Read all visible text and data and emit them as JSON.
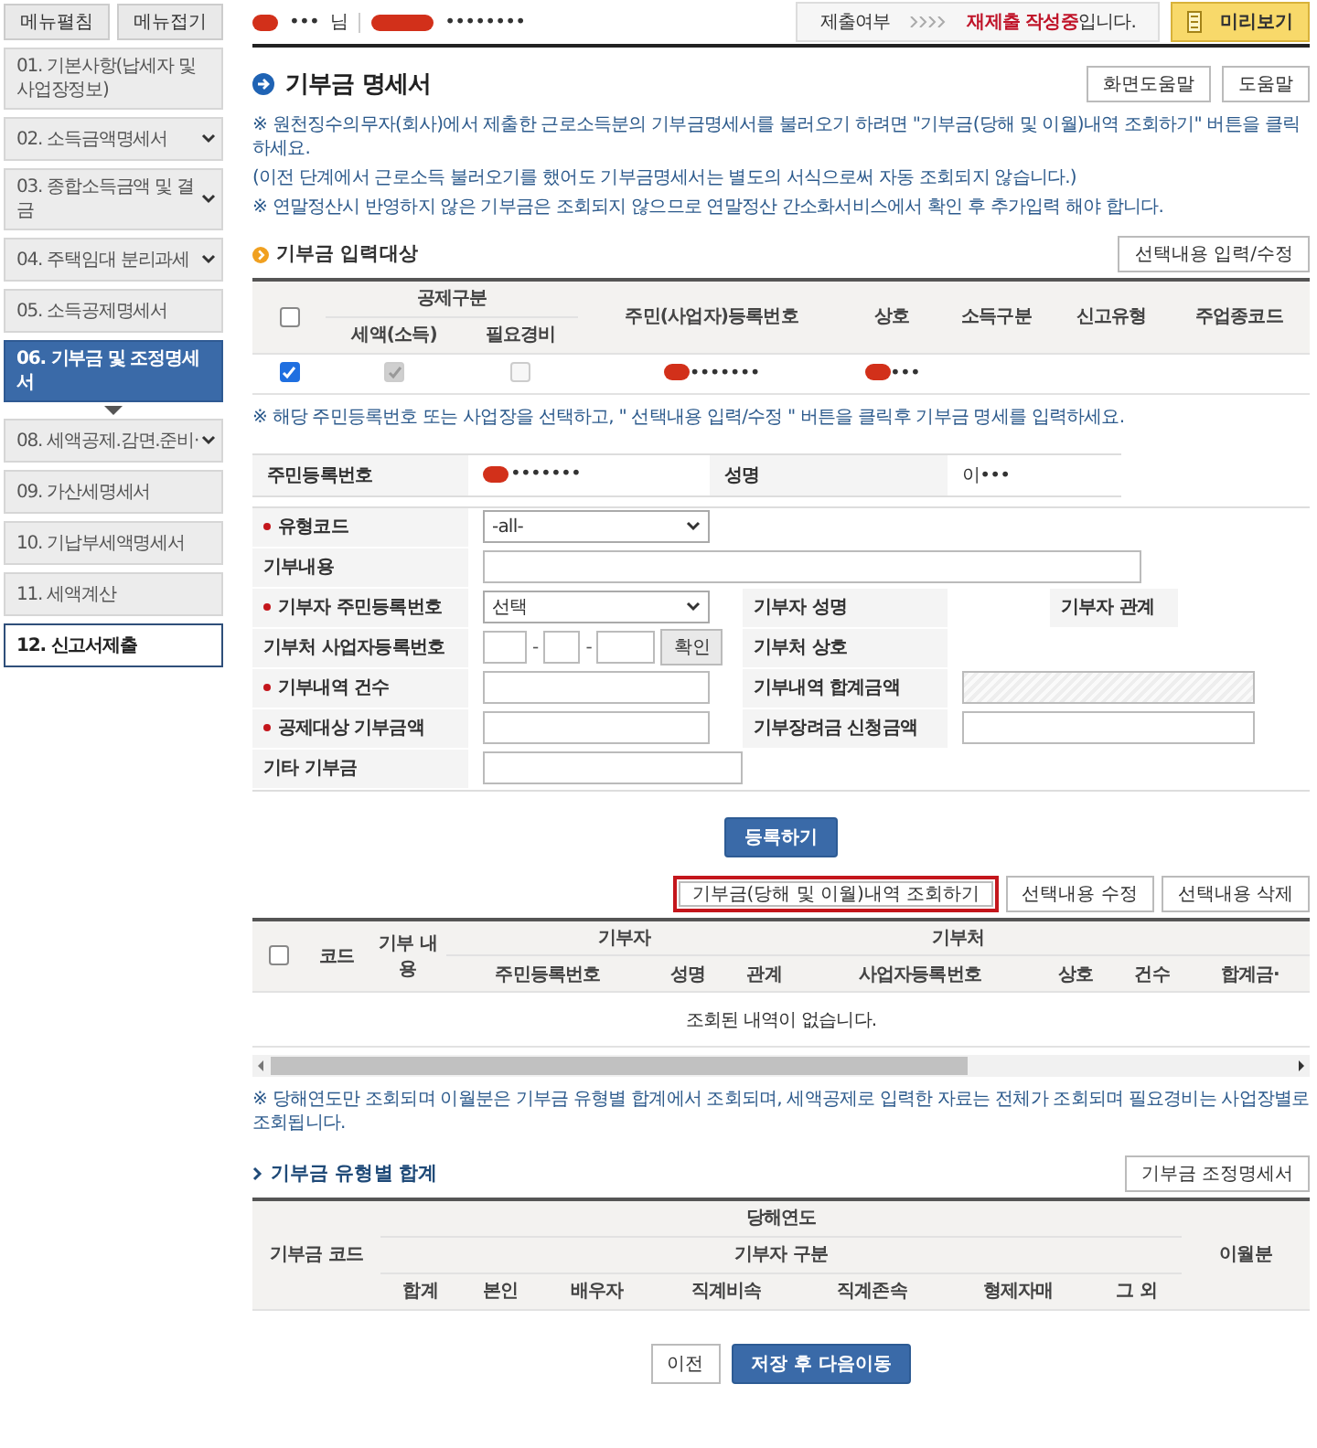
{
  "sidebar": {
    "buttons": [
      "메뉴펼침",
      "메뉴접기"
    ],
    "items": [
      {
        "label": "01. 기본사항(납세자 및 사업장정보)",
        "selected": false,
        "expandable": false,
        "emphasized": false
      },
      {
        "label": "02. 소득금액명세서",
        "selected": false,
        "expandable": true,
        "emphasized": false
      },
      {
        "label": "03. 종합소득금액 및 결 금",
        "selected": false,
        "expandable": true,
        "emphasized": false
      },
      {
        "label": "04. 주택임대 분리과세",
        "selected": false,
        "expandable": true,
        "emphasized": false
      },
      {
        "label": "05. 소득공제명세서",
        "selected": false,
        "expandable": false,
        "emphasized": false
      },
      {
        "label": "06. 기부금 및 조정명세서",
        "selected": true,
        "expandable": false,
        "emphasized": false
      },
      {
        "label": "08. 세액공제.감면.준비·",
        "selected": false,
        "expandable": true,
        "emphasized": false
      },
      {
        "label": "09. 가산세명세서",
        "selected": false,
        "expandable": false,
        "emphasized": false
      },
      {
        "label": "10. 기납부세액명세서",
        "selected": false,
        "expandable": false,
        "emphasized": false
      },
      {
        "label": "11. 세액계산",
        "selected": false,
        "expandable": false,
        "emphasized": false
      },
      {
        "label": "12. 신고서제출",
        "selected": false,
        "expandable": false,
        "emphasized": true
      }
    ]
  },
  "header": {
    "user": {
      "text": "•••",
      "redacted": true
    },
    "user_suffix": "님",
    "account": {
      "text": "••••••••",
      "redacted": true
    },
    "status": {
      "label": "제출여부",
      "value": "**재제출 작성중**입니다."
    },
    "preview_button": "미리보기"
  },
  "title": "기부금 명세서",
  "help_buttons": [
    "화면도움말",
    "도움말"
  ],
  "notes": [
    "※ 원천징수의무자(회사)에서 제출한 근로소득분의 기부금명세서를 불러오기 하려면 \"기부금(당해 및 이월)내역 조회하기\" 버튼을 클릭하세요.",
    "(이전 단계에서 근로소득 불러오기를 했어도 기부금명세서는 별도의 서식으로써 자동 조회되지 않습니다.)",
    "※ 연말정산시 반영하지 않은 기부금은 조회되지 않으므로 연말정산 간소화서비스에서 확인 후 추가입력 해야 합니다."
  ],
  "target_section": {
    "title": "기부금 입력대상",
    "button": "선택내용 입력/수정",
    "select_all": {
      "checked": false
    },
    "group": {
      "label": "공제구분",
      "columns": [
        "세액(소득)",
        "필요경비"
      ]
    },
    "columns": [
      "주민(사업자)등록번호",
      "상호",
      "소득구분",
      "신고유형",
      "주업종코드"
    ],
    "rows": [
      {
        "checked": true,
        "deduction_checks": [
          {
            "checked": true,
            "disabled": true
          },
          {
            "checked": false,
            "disabled": true
          }
        ],
        "id": {
          "text": "•••••••",
          "redacted": true
        },
        "name": {
          "text": "•••",
          "redacted": true
        }
      }
    ],
    "note": "※ 해당 주민등록번호 또는 사업장을 선택하고, \" 선택내용 입력/수정 \" 버튼을 클릭후 기부금 명세를 입력하세요."
  },
  "person": {
    "id_label": "주민등록번호",
    "id": {
      "text": "•••••••",
      "redacted": true
    },
    "name_label": "성명",
    "name": {
      "text": "이•••",
      "redacted": false
    }
  },
  "form": {
    "rows": [
      {
        "label": "유형코드",
        "required": true,
        "kind": "select",
        "value": "-all-"
      },
      {
        "label": "기부내용",
        "required": false,
        "kind": "text_wide"
      },
      {
        "label": "기부자 주민등록번호",
        "required": true,
        "kind": "select",
        "value": "선택",
        "side": [
          {
            "label": "기부자 성명"
          },
          {
            "label": "기부자 관계"
          }
        ]
      },
      {
        "label": "기부처 사업자등록번호",
        "required": false,
        "kind": "bizno",
        "separator": "-",
        "button": "확인",
        "side": [
          {
            "label": "기부처 상호"
          }
        ]
      },
      {
        "label": "기부내역 건수",
        "required": true,
        "kind": "text",
        "side": [
          {
            "label": "기부내역 합계금액",
            "kind": "readonly"
          }
        ]
      },
      {
        "label": "공제대상 기부금액",
        "required": true,
        "kind": "text",
        "side": [
          {
            "label": "기부장려금 신청금액",
            "kind": "text"
          }
        ]
      },
      {
        "label": "기타 기부금",
        "required": false,
        "kind": "text_medium"
      }
    ],
    "submit": "등록하기"
  },
  "list_buttons": [
    {
      "label": "기부금(당해 및 이월)내역 조회하기",
      "highlighted": true
    },
    {
      "label": "선택내용 수정",
      "highlighted": false
    },
    {
      "label": "선택내용 삭제",
      "highlighted": false
    }
  ],
  "list_table": {
    "select_all": {
      "checked": false
    },
    "columns": [
      "코드",
      "기부 내용"
    ],
    "groups": [
      {
        "label": "기부자",
        "columns": [
          "주민등록번호",
          "성명",
          "관계"
        ]
      },
      {
        "label": "기부처",
        "columns": [
          "사업자등록번호",
          "상호"
        ]
      },
      {
        "columns": [
          "건수",
          "합계금·"
        ]
      }
    ],
    "empty_message": "조회된 내역이 없습니다."
  },
  "list_note": "※ 당해연도만 조회되며 이월분은 기부금 유형별 합계에서 조회되며, 세액공제로 입력한 자료는 전체가 조회되며 필요경비는 사업장별로 조회됩니다.",
  "summary_section": {
    "title": "기부금 유형별 합계",
    "button": "기부금 조정명세서",
    "code_column": "기부금 코드",
    "group": "당해연도",
    "subgroup": "기부자 구분",
    "columns": [
      "합계",
      "본인",
      "배우자",
      "직계비속",
      "직계존속",
      "형제자매",
      "그 외"
    ],
    "last_column": "이월분"
  },
  "footer_buttons": [
    {
      "label": "이전",
      "kind": "secondary"
    },
    {
      "label": "저장 후 다음이동",
      "kind": "primary"
    }
  ]
}
